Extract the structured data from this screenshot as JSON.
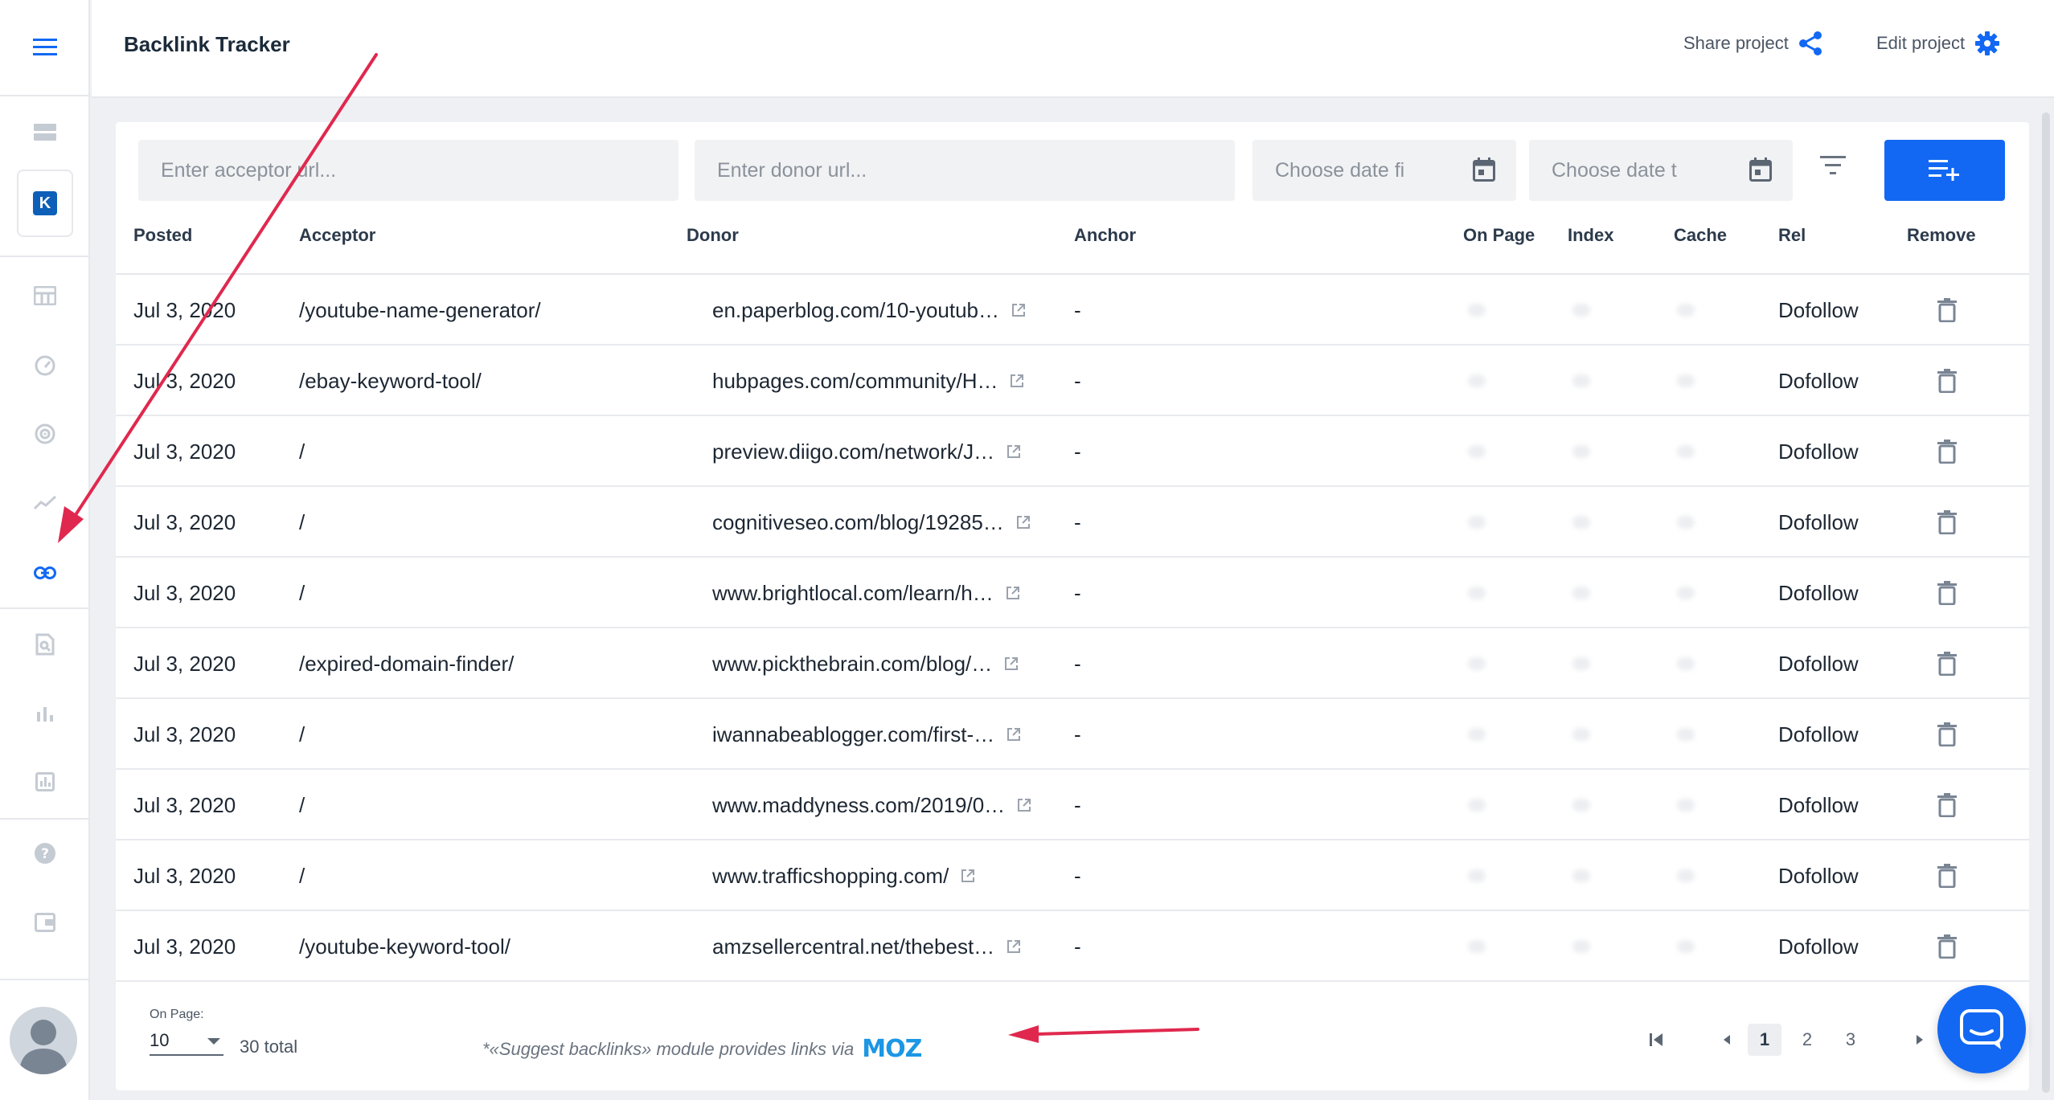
{
  "header": {
    "title": "Backlink Tracker",
    "share_label": "Share project",
    "edit_label": "Edit project"
  },
  "sidebar": {
    "project_initial": "K",
    "icons": [
      "menu-icon",
      "dashboard-icon",
      "project-icon",
      "table-icon",
      "speed-icon",
      "radar-icon",
      "trend-icon",
      "link-icon",
      "search-doc-icon",
      "bar-chart-icon",
      "report-icon",
      "help-icon",
      "wallet-icon",
      "avatar"
    ]
  },
  "filters": {
    "acceptor_placeholder": "Enter acceptor url...",
    "donor_placeholder": "Enter donor url...",
    "date_from_placeholder": "Choose date fi",
    "date_to_placeholder": "Choose date t"
  },
  "table": {
    "columns": {
      "posted": "Posted",
      "acceptor": "Acceptor",
      "donor": "Donor",
      "anchor": "Anchor",
      "on_page": "On Page",
      "index": "Index",
      "cache": "Cache",
      "rel": "Rel",
      "remove": "Remove"
    },
    "rows": [
      {
        "posted": "Jul 3, 2020",
        "acceptor": "/youtube-name-generator/",
        "donor": "en.paperblog.com/10-youtub…",
        "anchor": "-",
        "rel": "Dofollow"
      },
      {
        "posted": "Jul 3, 2020",
        "acceptor": "/ebay-keyword-tool/",
        "donor": "hubpages.com/community/H…",
        "anchor": "-",
        "rel": "Dofollow"
      },
      {
        "posted": "Jul 3, 2020",
        "acceptor": "/",
        "donor": "preview.diigo.com/network/J…",
        "anchor": "-",
        "rel": "Dofollow"
      },
      {
        "posted": "Jul 3, 2020",
        "acceptor": "/",
        "donor": "cognitiveseo.com/blog/19285…",
        "anchor": "-",
        "rel": "Dofollow"
      },
      {
        "posted": "Jul 3, 2020",
        "acceptor": "/",
        "donor": "www.brightlocal.com/learn/h…",
        "anchor": "-",
        "rel": "Dofollow"
      },
      {
        "posted": "Jul 3, 2020",
        "acceptor": "/expired-domain-finder/",
        "donor": "www.pickthebrain.com/blog/…",
        "anchor": "-",
        "rel": "Dofollow"
      },
      {
        "posted": "Jul 3, 2020",
        "acceptor": "/",
        "donor": "iwannabeablogger.com/first-…",
        "anchor": "-",
        "rel": "Dofollow"
      },
      {
        "posted": "Jul 3, 2020",
        "acceptor": "/",
        "donor": "www.maddyness.com/2019/0…",
        "anchor": "-",
        "rel": "Dofollow"
      },
      {
        "posted": "Jul 3, 2020",
        "acceptor": "/",
        "donor": "www.trafficshopping.com/",
        "anchor": "-",
        "rel": "Dofollow"
      },
      {
        "posted": "Jul 3, 2020",
        "acceptor": "/youtube-keyword-tool/",
        "donor": "amzsellercentral.net/thebest…",
        "anchor": "-",
        "rel": "Dofollow"
      }
    ]
  },
  "footer": {
    "on_page_label": "On Page:",
    "on_page_value": "10",
    "total": "30 total",
    "moz_note": "*«Suggest backlinks» module provides links via",
    "moz_logo": "MOZ",
    "pages": [
      "1",
      "2",
      "3"
    ],
    "current_page": "1"
  },
  "colors": {
    "accent": "#1268f3",
    "annotation_arrow": "#e0284e",
    "moz": "#1b97e4"
  }
}
